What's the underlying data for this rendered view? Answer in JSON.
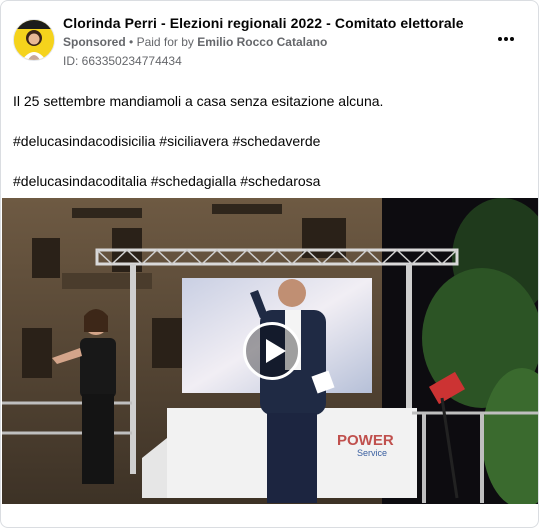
{
  "ad": {
    "page_name": "Clorinda Perri - Elezioni regionali 2022 - Comitato elettorale",
    "sponsored_label": "Sponsored",
    "separator": "•",
    "paid_for_prefix": "Paid for by",
    "payer": "Emilio Rocco Catalano",
    "id_label": "ID: 663350234774434",
    "more_icon": "more-horizontal-icon"
  },
  "post": {
    "line1": "Il 25 settembre mandiamoli a casa senza esitazione alcuna.",
    "line2": "#delucasindacodisicilia #siciliavera #schedaverde",
    "line3": "#delucasindacoditalia #schedagialla #schedarosa"
  },
  "video": {
    "play_icon": "play-icon",
    "sign_text_1": "POWER",
    "sign_text_2": "Service"
  }
}
